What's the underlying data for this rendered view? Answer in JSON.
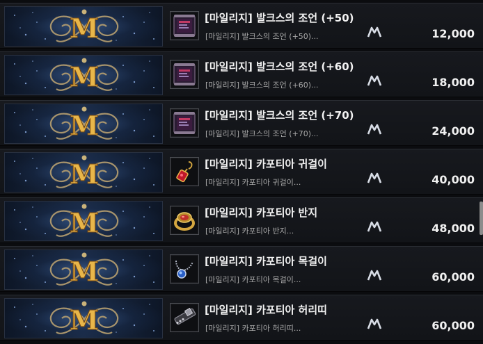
{
  "items": [
    {
      "title": "[마일리지] 발크스의 조언 (+50)",
      "desc": "[마일리지] 발크스의 조언 (+50)...",
      "price": "12,000",
      "icon": "scroll-icon"
    },
    {
      "title": "[마일리지] 발크스의 조언 (+60)",
      "desc": "[마일리지] 발크스의 조언 (+60)...",
      "price": "18,000",
      "icon": "scroll-icon"
    },
    {
      "title": "[마일리지] 발크스의 조언 (+70)",
      "desc": "[마일리지] 발크스의 조언 (+70)...",
      "price": "24,000",
      "icon": "scroll-icon"
    },
    {
      "title": "[마일리지] 카포티아 귀걸이",
      "desc": "[마일리지] 카포티아 귀걸이...",
      "price": "40,000",
      "icon": "earring-icon"
    },
    {
      "title": "[마일리지] 카포티아 반지",
      "desc": "[마일리지] 카포티아 반지...",
      "price": "48,000",
      "icon": "ring-icon"
    },
    {
      "title": "[마일리지] 카포티아 목걸이",
      "desc": "[마일리지] 카포티아 목걸이...",
      "price": "60,000",
      "icon": "necklace-icon"
    },
    {
      "title": "[마일리지] 카포티아 허리띠",
      "desc": "[마일리지] 카포티아 허리띠...",
      "price": "60,000",
      "icon": "belt-icon"
    }
  ],
  "colors": {
    "gold": "#e8b64a",
    "title": "#f2f2f2",
    "desc": "#a8a8a8"
  }
}
